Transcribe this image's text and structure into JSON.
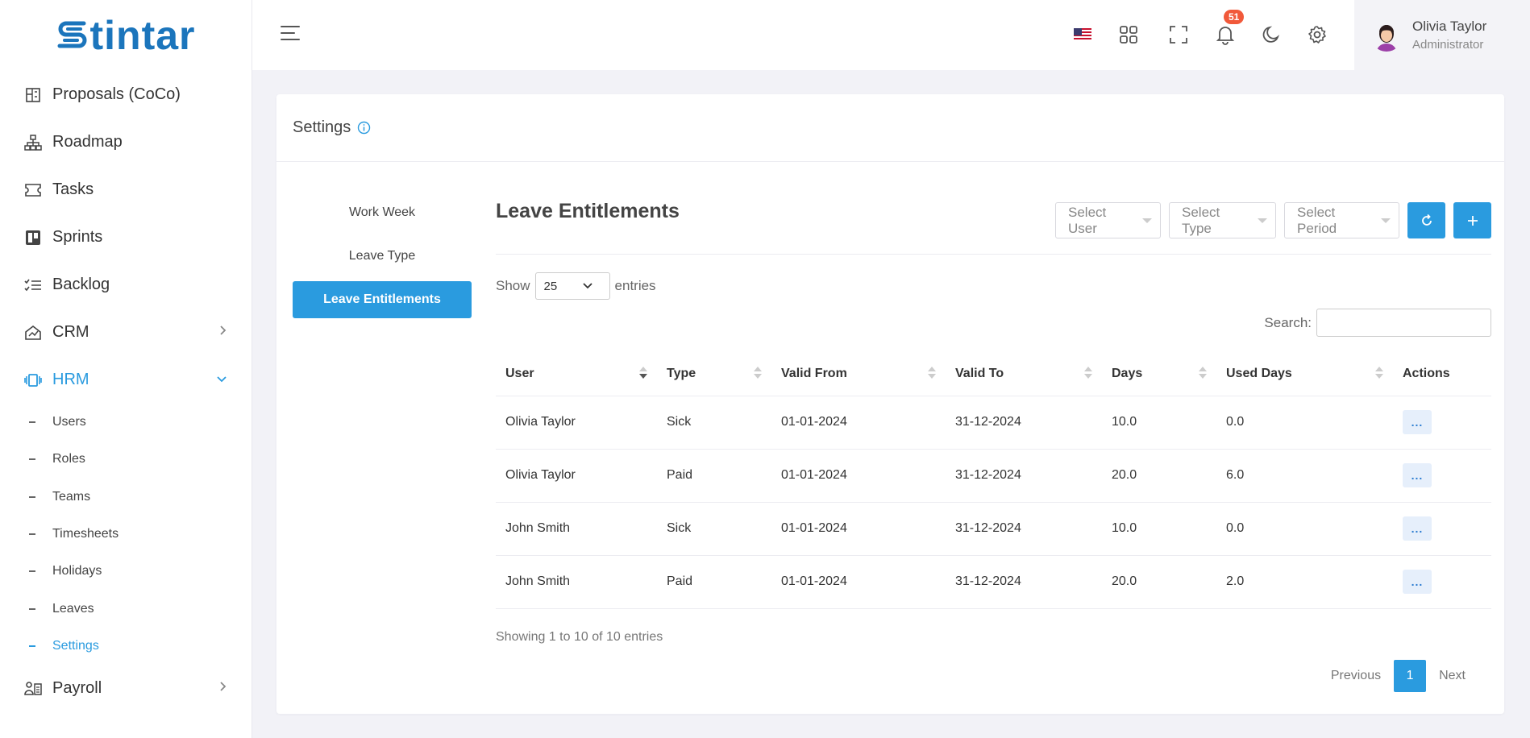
{
  "app": {
    "logo_text": "tintar",
    "brand_color": "#1b75bc",
    "accent_color": "#2a9bdf"
  },
  "sidebar": {
    "items": [
      {
        "label": "Proposals (CoCo)",
        "icon": "proposals-icon"
      },
      {
        "label": "Roadmap",
        "icon": "sitemap-icon"
      },
      {
        "label": "Tasks",
        "icon": "ticket-icon"
      },
      {
        "label": "Sprints",
        "icon": "board-icon"
      },
      {
        "label": "Backlog",
        "icon": "checklist-icon"
      },
      {
        "label": "CRM",
        "icon": "crm-icon"
      },
      {
        "label": "HRM",
        "icon": "hrm-icon"
      },
      {
        "label": "Payroll",
        "icon": "payroll-icon"
      }
    ],
    "hrm_sub": [
      "Users",
      "Roles",
      "Teams",
      "Timesheets",
      "Holidays",
      "Leaves",
      "Settings"
    ]
  },
  "header": {
    "notification_count": "51",
    "user_name": "Olivia Taylor",
    "user_role": "Administrator"
  },
  "page": {
    "title": "Settings",
    "tabs": [
      "Work Week",
      "Leave Type",
      "Leave Entitlements"
    ],
    "section_title": "Leave Entitlements",
    "filters": {
      "user": "Select User",
      "type": "Select Type",
      "period": "Select Period"
    },
    "show_label": "Show",
    "entries_label": "entries",
    "page_length": "25",
    "search_label": "Search:"
  },
  "table": {
    "columns": [
      "User",
      "Type",
      "Valid From",
      "Valid To",
      "Days",
      "Used Days",
      "Actions"
    ],
    "rows": [
      {
        "user": "Olivia Taylor",
        "type": "Sick",
        "from": "01-01-2024",
        "to": "31-12-2024",
        "days": "10.0",
        "used": "0.0",
        "action": "..."
      },
      {
        "user": "Olivia Taylor",
        "type": "Paid",
        "from": "01-01-2024",
        "to": "31-12-2024",
        "days": "20.0",
        "used": "6.0",
        "action": "..."
      },
      {
        "user": "John Smith",
        "type": "Sick",
        "from": "01-01-2024",
        "to": "31-12-2024",
        "days": "10.0",
        "used": "0.0",
        "action": "..."
      },
      {
        "user": "John Smith",
        "type": "Paid",
        "from": "01-01-2024",
        "to": "31-12-2024",
        "days": "20.0",
        "used": "2.0",
        "action": "..."
      }
    ]
  },
  "footer": {
    "info": "Showing 1 to 10 of 10 entries",
    "previous": "Previous",
    "current_page": "1",
    "next": "Next"
  }
}
